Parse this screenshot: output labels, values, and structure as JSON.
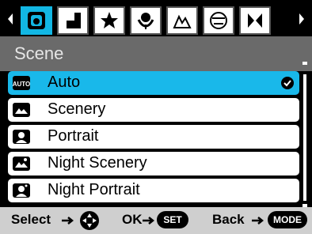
{
  "tabs": [
    {
      "icon": "scene-mode-icon",
      "active": true
    },
    {
      "icon": "exposure-icon",
      "active": false
    },
    {
      "icon": "star-icon",
      "active": false
    },
    {
      "icon": "flower-macro-icon",
      "active": false
    },
    {
      "icon": "mountain-landscape-icon",
      "active": false
    },
    {
      "icon": "filter-effect-icon",
      "active": false
    },
    {
      "icon": "bracket-icon",
      "active": false
    }
  ],
  "header": {
    "title": "Scene"
  },
  "items": [
    {
      "icon": "auto-icon",
      "label": "Auto",
      "selected": true
    },
    {
      "icon": "scenery-icon",
      "label": "Scenery",
      "selected": false
    },
    {
      "icon": "portrait-icon",
      "label": "Portrait",
      "selected": false
    },
    {
      "icon": "night-scenery-icon",
      "label": "Night Scenery",
      "selected": false
    },
    {
      "icon": "night-portrait-icon",
      "label": "Night Portrait",
      "selected": false
    }
  ],
  "footer": {
    "select_label": "Select",
    "ok_label": "OK",
    "set_label": "SET",
    "back_label": "Back",
    "mode_label": "MODE"
  },
  "colors": {
    "accent": "#19b8ea",
    "header": "#6a6a6a",
    "footer": "#cfcfcf"
  }
}
